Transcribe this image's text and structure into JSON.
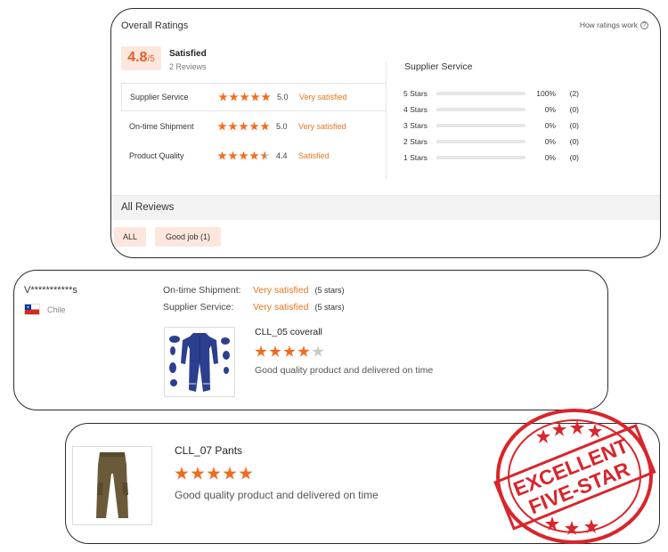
{
  "ratings": {
    "title": "Overall Ratings",
    "how_link": "How ratings work",
    "help_glyph": "?",
    "score": "4.8",
    "score_suffix": "/5",
    "satisfaction": "Satisfied",
    "reviews_count": "2 Reviews",
    "categories": [
      {
        "name": "Supplier Service",
        "stars": 5,
        "score": "5.0",
        "label": "Very satisfied"
      },
      {
        "name": "On-time Shipment",
        "stars": 5,
        "score": "5.0",
        "label": "Very satisfied"
      },
      {
        "name": "Product Quality",
        "stars": 4.4,
        "score": "4.4",
        "label": "Satisfied"
      }
    ],
    "distribution": {
      "title": "Supplier Service",
      "rows": [
        {
          "label": "5 Stars",
          "percent": 100,
          "percent_text": "100%",
          "count": "(2)"
        },
        {
          "label": "4 Stars",
          "percent": 0,
          "percent_text": "0%",
          "count": "(0)"
        },
        {
          "label": "3 Stars",
          "percent": 0,
          "percent_text": "0%",
          "count": "(0)"
        },
        {
          "label": "2 Stars",
          "percent": 0,
          "percent_text": "0%",
          "count": "(0)"
        },
        {
          "label": "1 Stars",
          "percent": 0,
          "percent_text": "0%",
          "count": "(0)"
        }
      ]
    },
    "all_reviews_title": "All Reviews",
    "filters": {
      "all": "ALL",
      "good_job": "Good job (1)"
    }
  },
  "review1": {
    "username": "V***********s",
    "country": "Chile",
    "shipment_label": "On-time Shipment:",
    "shipment_value": "Very satisfied",
    "shipment_stars": "(5 stars)",
    "service_label": "Supplier Service:",
    "service_value": "Very satisfied",
    "service_stars": "(5 stars)",
    "product": "CLL_05 coverall",
    "rating": 4,
    "text": "Good quality product and delivered on time"
  },
  "review2": {
    "product": "CLL_07 Pants",
    "rating": 5,
    "text": "Good quality product and delivered on time"
  },
  "stamp": {
    "line1": "EXCELLENT",
    "line2": "FIVE-STAR"
  },
  "colors": {
    "accent": "#f26b1d",
    "stamp": "#d9252b",
    "chip_bg": "#fde7dc"
  },
  "icons": {
    "help": "help-circle-icon",
    "flag": "chile-flag-icon",
    "star": "star-icon"
  }
}
